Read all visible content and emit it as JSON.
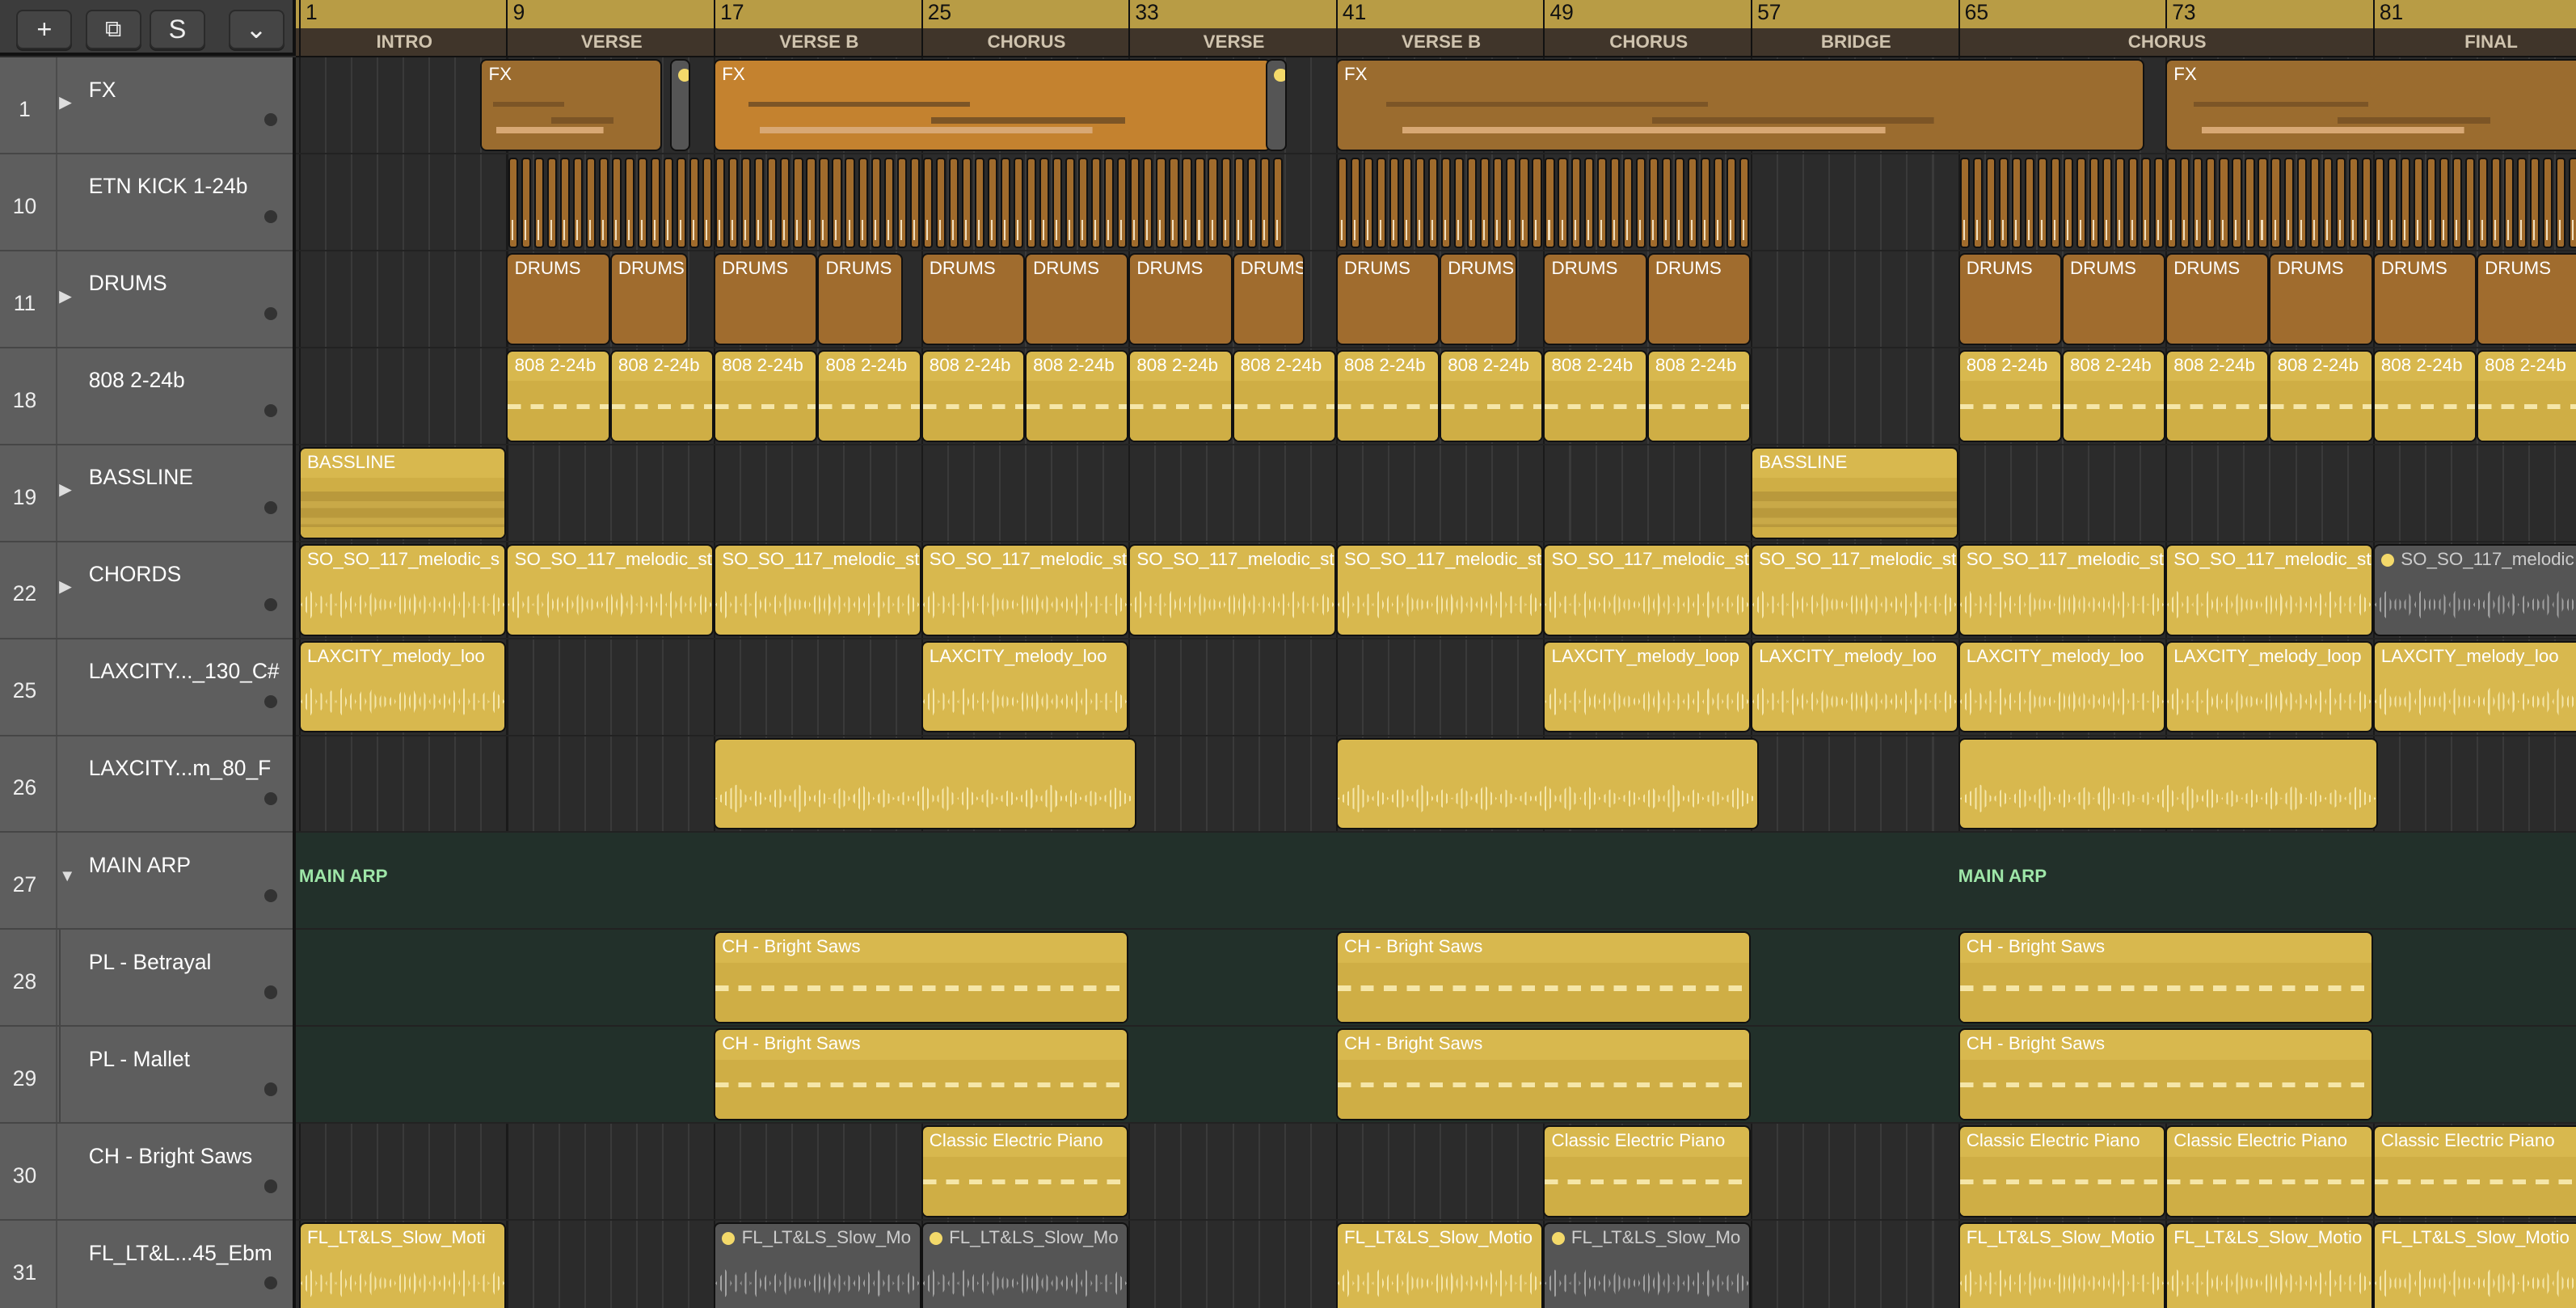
{
  "toolbar": {
    "add": "+",
    "duplicate": "⧉",
    "solo": "S",
    "menu": "⌄"
  },
  "ruler": {
    "bars": [
      "1",
      "9",
      "17",
      "25",
      "33",
      "41",
      "49",
      "57",
      "65",
      "73",
      "81"
    ]
  },
  "markers": [
    {
      "label": "INTRO",
      "start": 1,
      "end": 9
    },
    {
      "label": "VERSE",
      "start": 9,
      "end": 17
    },
    {
      "label": "VERSE B",
      "start": 17,
      "end": 25
    },
    {
      "label": "CHORUS",
      "start": 25,
      "end": 33
    },
    {
      "label": "VERSE",
      "start": 33,
      "end": 41
    },
    {
      "label": "VERSE B",
      "start": 41,
      "end": 49
    },
    {
      "label": "CHORUS",
      "start": 49,
      "end": 57
    },
    {
      "label": "BRIDGE",
      "start": 57,
      "end": 65
    },
    {
      "label": "CHORUS",
      "start": 65,
      "end": 81
    },
    {
      "label": "FINAL",
      "start": 81,
      "end": 90
    }
  ],
  "tracks": [
    {
      "num": "1",
      "name": "FX",
      "expander": "right",
      "regions": [
        {
          "label": "FX",
          "start": 8,
          "len": 7,
          "style": "orange",
          "content": "notes"
        },
        {
          "label": "",
          "start": 15.3,
          "len": 0.8,
          "style": "grey",
          "content": "",
          "dot": true
        },
        {
          "label": "FX",
          "start": 17,
          "len": 21.5,
          "style": "orange2",
          "content": "notes"
        },
        {
          "label": "",
          "start": 38.3,
          "len": 0.8,
          "style": "grey",
          "content": "",
          "dot": true
        },
        {
          "label": "FX",
          "start": 41,
          "len": 31.2,
          "style": "orange",
          "content": "notes"
        },
        {
          "label": "FX",
          "start": 73,
          "len": 17,
          "style": "orange",
          "content": "notes"
        }
      ]
    },
    {
      "num": "10",
      "name": "ETN KICK 1-24b",
      "kick_ranges": [
        [
          9,
          39
        ],
        [
          41,
          57
        ],
        [
          65,
          89
        ]
      ]
    },
    {
      "num": "11",
      "name": "DRUMS",
      "expander": "right",
      "regions": [
        {
          "label": "DRUMS",
          "start": 9,
          "len": 4,
          "style": "brown"
        },
        {
          "label": "DRUMS",
          "start": 13,
          "len": 3,
          "style": "brown"
        },
        {
          "label": "DRUMS",
          "start": 17,
          "len": 4,
          "style": "brown"
        },
        {
          "label": "DRUMS",
          "start": 21,
          "len": 3.3,
          "style": "brown"
        },
        {
          "label": "DRUMS",
          "start": 25,
          "len": 4,
          "style": "brown"
        },
        {
          "label": "DRUMS",
          "start": 29,
          "len": 4,
          "style": "brown"
        },
        {
          "label": "DRUMS",
          "start": 33,
          "len": 4,
          "style": "brown"
        },
        {
          "label": "DRUMS",
          "start": 37,
          "len": 2.8,
          "style": "brown"
        },
        {
          "label": "DRUMS",
          "start": 41,
          "len": 4,
          "style": "brown"
        },
        {
          "label": "DRUMS",
          "start": 45,
          "len": 3,
          "style": "brown"
        },
        {
          "label": "DRUMS",
          "start": 49,
          "len": 4,
          "style": "brown"
        },
        {
          "label": "DRUMS",
          "start": 53,
          "len": 4,
          "style": "brown"
        },
        {
          "label": "DRUMS",
          "start": 65,
          "len": 4,
          "style": "brown"
        },
        {
          "label": "DRUMS",
          "start": 69,
          "len": 4,
          "style": "brown"
        },
        {
          "label": "DRUMS",
          "start": 73,
          "len": 4,
          "style": "brown"
        },
        {
          "label": "DRUMS",
          "start": 77,
          "len": 4,
          "style": "brown"
        },
        {
          "label": "DRUMS",
          "start": 81,
          "len": 4,
          "style": "brown"
        },
        {
          "label": "DRUMS",
          "start": 85,
          "len": 5,
          "style": "brown"
        }
      ]
    },
    {
      "num": "18",
      "name": "808 2-24b",
      "regions": [
        {
          "label": "808 2-24b",
          "start": 9,
          "len": 4,
          "style": "gold",
          "content": "midi"
        },
        {
          "label": "808 2-24b",
          "start": 13,
          "len": 4,
          "style": "gold",
          "content": "midi"
        },
        {
          "label": "808 2-24b",
          "start": 17,
          "len": 4,
          "style": "gold",
          "content": "midi"
        },
        {
          "label": "808 2-24b",
          "start": 21,
          "len": 4,
          "style": "gold",
          "content": "midi"
        },
        {
          "label": "808 2-24b",
          "start": 25,
          "len": 4,
          "style": "gold",
          "content": "midi"
        },
        {
          "label": "808 2-24b",
          "start": 29,
          "len": 4,
          "style": "gold",
          "content": "midi"
        },
        {
          "label": "808 2-24b",
          "start": 33,
          "len": 4,
          "style": "gold",
          "content": "midi"
        },
        {
          "label": "808 2-24b",
          "start": 37,
          "len": 4,
          "style": "gold",
          "content": "midi"
        },
        {
          "label": "808 2-24b",
          "start": 41,
          "len": 4,
          "style": "gold",
          "content": "midi"
        },
        {
          "label": "808 2-24b",
          "start": 45,
          "len": 4,
          "style": "gold",
          "content": "midi"
        },
        {
          "label": "808 2-24b",
          "start": 49,
          "len": 4,
          "style": "gold",
          "content": "midi"
        },
        {
          "label": "808 2-24b",
          "start": 53,
          "len": 4,
          "style": "gold",
          "content": "midi"
        },
        {
          "label": "808 2-24b",
          "start": 65,
          "len": 4,
          "style": "gold",
          "content": "midi"
        },
        {
          "label": "808 2-24b",
          "start": 69,
          "len": 4,
          "style": "gold",
          "content": "midi"
        },
        {
          "label": "808 2-24b",
          "start": 73,
          "len": 4,
          "style": "gold",
          "content": "midi"
        },
        {
          "label": "808 2-24b",
          "start": 77,
          "len": 4,
          "style": "gold",
          "content": "midi"
        },
        {
          "label": "808 2-24b",
          "start": 81,
          "len": 4,
          "style": "gold",
          "content": "midi"
        },
        {
          "label": "808 2-24b",
          "start": 85,
          "len": 5,
          "style": "gold",
          "content": "midi"
        }
      ]
    },
    {
      "num": "19",
      "name": "BASSLINE",
      "expander": "right",
      "regions": [
        {
          "label": "BASSLINE",
          "start": 1,
          "len": 8,
          "style": "gold",
          "content": "bass"
        },
        {
          "label": "BASSLINE",
          "start": 57,
          "len": 8,
          "style": "gold",
          "content": "bass"
        }
      ]
    },
    {
      "num": "22",
      "name": "CHORDS",
      "expander": "right",
      "regions": [
        {
          "label": "SO_SO_117_melodic_s",
          "start": 1,
          "len": 8,
          "style": "gold",
          "content": "wave"
        },
        {
          "label": "SO_SO_117_melodic_st",
          "start": 9,
          "len": 8,
          "style": "gold",
          "content": "wave"
        },
        {
          "label": "SO_SO_117_melodic_st",
          "start": 17,
          "len": 8,
          "style": "gold",
          "content": "wave"
        },
        {
          "label": "SO_SO_117_melodic_st",
          "start": 25,
          "len": 8,
          "style": "gold",
          "content": "wave"
        },
        {
          "label": "SO_SO_117_melodic_st",
          "start": 33,
          "len": 8,
          "style": "gold",
          "content": "wave"
        },
        {
          "label": "SO_SO_117_melodic_st",
          "start": 41,
          "len": 8,
          "style": "gold",
          "content": "wave"
        },
        {
          "label": "SO_SO_117_melodic_st",
          "start": 49,
          "len": 8,
          "style": "gold",
          "content": "wave"
        },
        {
          "label": "SO_SO_117_melodic_st",
          "start": 57,
          "len": 8,
          "style": "gold",
          "content": "wave"
        },
        {
          "label": "SO_SO_117_melodic_st",
          "start": 65,
          "len": 8,
          "style": "gold",
          "content": "wave"
        },
        {
          "label": "SO_SO_117_melodic_st",
          "start": 73,
          "len": 8,
          "style": "gold",
          "content": "wave"
        },
        {
          "label": "SO_SO_117_melodic",
          "start": 81,
          "len": 9,
          "style": "grey",
          "content": "wave",
          "dot": true
        }
      ]
    },
    {
      "num": "25",
      "name": "LAXCITY..._130_C#",
      "regions": [
        {
          "label": "LAXCITY_melody_loo",
          "start": 1,
          "len": 8,
          "style": "gold",
          "content": "wave"
        },
        {
          "label": "LAXCITY_melody_loo",
          "start": 25,
          "len": 8,
          "style": "gold",
          "content": "wave"
        },
        {
          "label": "LAXCITY_melody_loop",
          "start": 49,
          "len": 8,
          "style": "gold",
          "content": "wave"
        },
        {
          "label": "LAXCITY_melody_loo",
          "start": 57,
          "len": 8,
          "style": "gold",
          "content": "wave"
        },
        {
          "label": "LAXCITY_melody_loo",
          "start": 65,
          "len": 8,
          "style": "gold",
          "content": "wave"
        },
        {
          "label": "LAXCITY_melody_loop",
          "start": 73,
          "len": 8,
          "style": "gold",
          "content": "wave"
        },
        {
          "label": "LAXCITY_melody_loo",
          "start": 81,
          "len": 9,
          "style": "gold",
          "content": "wave"
        }
      ]
    },
    {
      "num": "26",
      "name": "LAXCITY...m_80_F",
      "regions": [
        {
          "label": "",
          "start": 17,
          "len": 16.3,
          "style": "gold",
          "content": "wave"
        },
        {
          "label": "",
          "start": 41,
          "len": 16.3,
          "style": "gold",
          "content": "wave"
        },
        {
          "label": "",
          "start": 65,
          "len": 16.2,
          "style": "gold",
          "content": "wave"
        }
      ]
    },
    {
      "num": "27",
      "name": "MAIN ARP",
      "expander": "down",
      "folder": true,
      "folder_labels": [
        {
          "label": "MAIN ARP",
          "start": 1
        },
        {
          "label": "MAIN ARP",
          "start": 65
        }
      ]
    },
    {
      "num": "28",
      "name": "PL - Betrayal",
      "indent": true,
      "folder": true,
      "regions": [
        {
          "label": "CH - Bright Saws",
          "start": 17,
          "len": 16,
          "style": "gold",
          "content": "midi"
        },
        {
          "label": "CH - Bright Saws",
          "start": 41,
          "len": 16,
          "style": "gold",
          "content": "midi"
        },
        {
          "label": "CH - Bright Saws",
          "start": 65,
          "len": 16,
          "style": "gold",
          "content": "midi"
        }
      ]
    },
    {
      "num": "29",
      "name": "PL - Mallet",
      "indent": true,
      "folder": true,
      "regions": [
        {
          "label": "CH - Bright Saws",
          "start": 17,
          "len": 16,
          "style": "gold",
          "content": "midi"
        },
        {
          "label": "CH - Bright Saws",
          "start": 41,
          "len": 16,
          "style": "gold",
          "content": "midi"
        },
        {
          "label": "CH - Bright Saws",
          "start": 65,
          "len": 16,
          "style": "gold",
          "content": "midi"
        }
      ]
    },
    {
      "num": "30",
      "name": "CH - Bright Saws",
      "regions": [
        {
          "label": "Classic Electric Piano",
          "start": 25,
          "len": 8,
          "style": "gold",
          "content": "midi"
        },
        {
          "label": "Classic Electric Piano",
          "start": 49,
          "len": 8,
          "style": "gold",
          "content": "midi"
        },
        {
          "label": "Classic Electric Piano",
          "start": 65,
          "len": 8,
          "style": "gold",
          "content": "midi"
        },
        {
          "label": "Classic Electric Piano",
          "start": 73,
          "len": 8,
          "style": "gold",
          "content": "midi"
        },
        {
          "label": "Classic Electric Piano",
          "start": 81,
          "len": 9,
          "style": "gold",
          "content": "midi"
        }
      ]
    },
    {
      "num": "31",
      "name": "FL_LT&L...45_Ebm",
      "regions": [
        {
          "label": "FL_LT&LS_Slow_Moti",
          "start": 1,
          "len": 8,
          "style": "gold",
          "content": "wave"
        },
        {
          "label": "FL_LT&LS_Slow_Mo",
          "start": 17,
          "len": 8,
          "style": "grey",
          "content": "wave",
          "dot": true
        },
        {
          "label": "FL_LT&LS_Slow_Mo",
          "start": 25,
          "len": 8,
          "style": "grey",
          "content": "wave",
          "dot": true
        },
        {
          "label": "FL_LT&LS_Slow_Motio",
          "start": 41,
          "len": 8,
          "style": "gold",
          "content": "wave"
        },
        {
          "label": "FL_LT&LS_Slow_Mo",
          "start": 49,
          "len": 8,
          "style": "grey",
          "content": "wave",
          "dot": true
        },
        {
          "label": "FL_LT&LS_Slow_Motio",
          "start": 65,
          "len": 8,
          "style": "gold",
          "content": "wave"
        },
        {
          "label": "FL_LT&LS_Slow_Motio",
          "start": 73,
          "len": 8,
          "style": "gold",
          "content": "wave"
        },
        {
          "label": "FL_LT&LS_Slow_Motio",
          "start": 81,
          "len": 9,
          "style": "gold",
          "content": "wave"
        }
      ]
    }
  ]
}
